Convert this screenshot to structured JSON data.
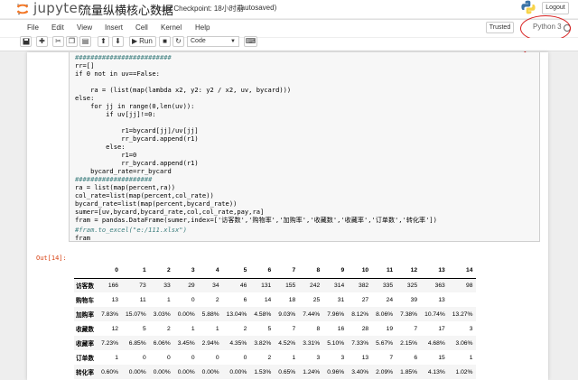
{
  "header": {
    "logo_text": "jupyter",
    "notebook_title": "流量纵横核心数据",
    "checkpoint": "Last Checkpoint: 18小时前",
    "autosave": "(autosaved)",
    "logout_label": "Logout"
  },
  "menubar": {
    "items": [
      "File",
      "Edit",
      "View",
      "Insert",
      "Cell",
      "Kernel",
      "Help"
    ],
    "trusted_label": "Trusted",
    "kernel_name": "Python 3"
  },
  "toolbar": {
    "run_label": "Run",
    "cell_type": "Code"
  },
  "code_cell": {
    "lines": [
      "#########################",
      "rr=[]",
      "if 0 not in uv==False:",
      "",
      "    ra = (list(map(lambda x2, y2: y2 / x2, uv, bycard)))",
      "else:",
      "    for jj in range(0,len(uv)):",
      "        if uv[jj]!=0:",
      "",
      "            r1=bycard[jj]/uv[jj]",
      "            rr_bycard.append(r1)",
      "        else:",
      "            r1=0",
      "            rr_bycard.append(r1)",
      "    bycard_rate=rr_bycard",
      "####################",
      "ra = list(map(percent,ra))",
      "col_rate=list(map(percent,col_rate))",
      "bycard_rate=list(map(percent,bycard_rate))",
      "sumer=[uv,bycard,bycard_rate,col,col_rate,pay,ra]",
      "fram = pandas.DataFrame(sumer,index=['访客数','购物率','加购率','收藏数','收藏率','订单数','转化率'])",
      "",
      "#fram.to_excel(\"e:/111.xlsx\")",
      "fram"
    ]
  },
  "output": {
    "prompt": "Out[14]:",
    "columns": [
      "",
      "0",
      "1",
      "2",
      "3",
      "4",
      "5",
      "6",
      "7",
      "8",
      "9",
      "10",
      "11",
      "12",
      "13",
      "14"
    ],
    "rows": [
      {
        "label": "访客数",
        "values": [
          "166",
          "73",
          "33",
          "29",
          "34",
          "46",
          "131",
          "155",
          "242",
          "314",
          "382",
          "335",
          "325",
          "363",
          "98"
        ]
      },
      {
        "label": "购物车",
        "values": [
          "13",
          "11",
          "1",
          "0",
          "2",
          "6",
          "14",
          "18",
          "25",
          "31",
          "27",
          "24",
          "39",
          "13",
          ""
        ]
      },
      {
        "label": "加购率",
        "values": [
          "7.83%",
          "15.07%",
          "3.03%",
          "0.00%",
          "5.88%",
          "13.04%",
          "4.58%",
          "9.03%",
          "7.44%",
          "7.96%",
          "8.12%",
          "8.06%",
          "7.38%",
          "10.74%",
          "13.27%"
        ]
      },
      {
        "label": "收藏数",
        "values": [
          "12",
          "5",
          "2",
          "1",
          "1",
          "2",
          "5",
          "7",
          "8",
          "16",
          "28",
          "19",
          "7",
          "17",
          "3"
        ]
      },
      {
        "label": "收藏率",
        "values": [
          "7.23%",
          "6.85%",
          "6.06%",
          "3.45%",
          "2.94%",
          "4.35%",
          "3.82%",
          "4.52%",
          "3.31%",
          "5.10%",
          "7.33%",
          "5.67%",
          "2.15%",
          "4.68%",
          "3.06%"
        ]
      },
      {
        "label": "订单数",
        "values": [
          "1",
          "0",
          "0",
          "0",
          "0",
          "0",
          "2",
          "1",
          "3",
          "3",
          "13",
          "7",
          "6",
          "15",
          "1"
        ]
      },
      {
        "label": "转化率",
        "values": [
          "0.60%",
          "0.00%",
          "0.00%",
          "0.00%",
          "0.00%",
          "0.00%",
          "1.53%",
          "0.65%",
          "1.24%",
          "0.96%",
          "3.40%",
          "2.09%",
          "1.85%",
          "4.13%",
          "1.02%"
        ]
      }
    ]
  },
  "colors": {
    "annotation": "#d81f1f",
    "output_prompt": "#d84315",
    "jupyter_orange": "#f37726"
  }
}
